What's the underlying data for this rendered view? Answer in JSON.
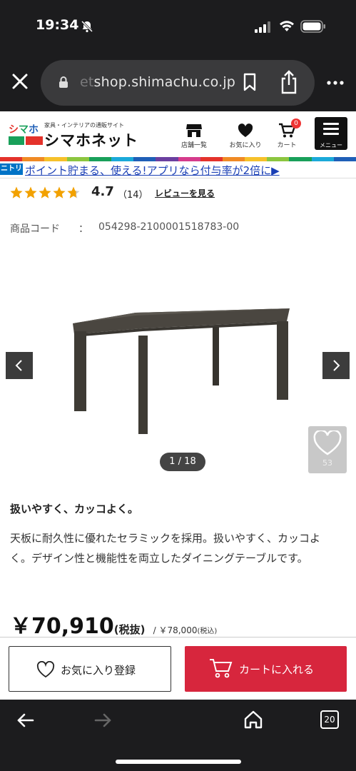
{
  "status_bar": {
    "time": "19:34"
  },
  "browser": {
    "url_prefix": "et",
    "url": "shop.shimachu.co.jp",
    "tabs_count": "20"
  },
  "site": {
    "tagline": "家具・インテリアの通販サイト",
    "name": "シマホネット",
    "nav": {
      "stores": "店舗一覧",
      "favorites": "お気に入り",
      "cart": "カート",
      "cart_count": "0",
      "menu": "メニュー"
    },
    "rainbow_colors": [
      "#e4322b",
      "#f08a24",
      "#f6c12a",
      "#8cc63f",
      "#19a05a",
      "#1ba9d9",
      "#1f5fb7",
      "#6b3fa0",
      "#d53b8b",
      "#e4322b",
      "#f08a24",
      "#f6c12a",
      "#8cc63f",
      "#19a05a",
      "#1ba9d9",
      "#1f5fb7"
    ]
  },
  "promo": {
    "tag": "ニトリ",
    "text": "ポイント貯まる、使える!アプリなら付与率が2倍に▶"
  },
  "product": {
    "rating": "4.7",
    "rating_value": 4.7,
    "review_count": "（14）",
    "review_link": "レビューを見る",
    "code_label": "商品コード",
    "code_sep": "：",
    "code": "054298-2100001518783-00",
    "image_counter": "1 / 18",
    "favorite_count": "53",
    "catchphrase": "扱いやすく、カッコよく。",
    "description": "天板に耐久性に優れたセラミックを採用。扱いやすく、カッコよく。デザイン性と機能性を両立したダイニングテーブルです。",
    "price": "￥70,910",
    "tax_excluded": "(税抜)",
    "price_incl_sep": "/",
    "price_incl": "￥78,000",
    "tax_included": "(税込)"
  },
  "actions": {
    "favorite_register": "お気に入り登録",
    "add_to_cart": "カートに入れる"
  },
  "colors": {
    "cart_button": "#d7263d",
    "promo_link": "#1a3fb5",
    "star": "#f2a100"
  }
}
